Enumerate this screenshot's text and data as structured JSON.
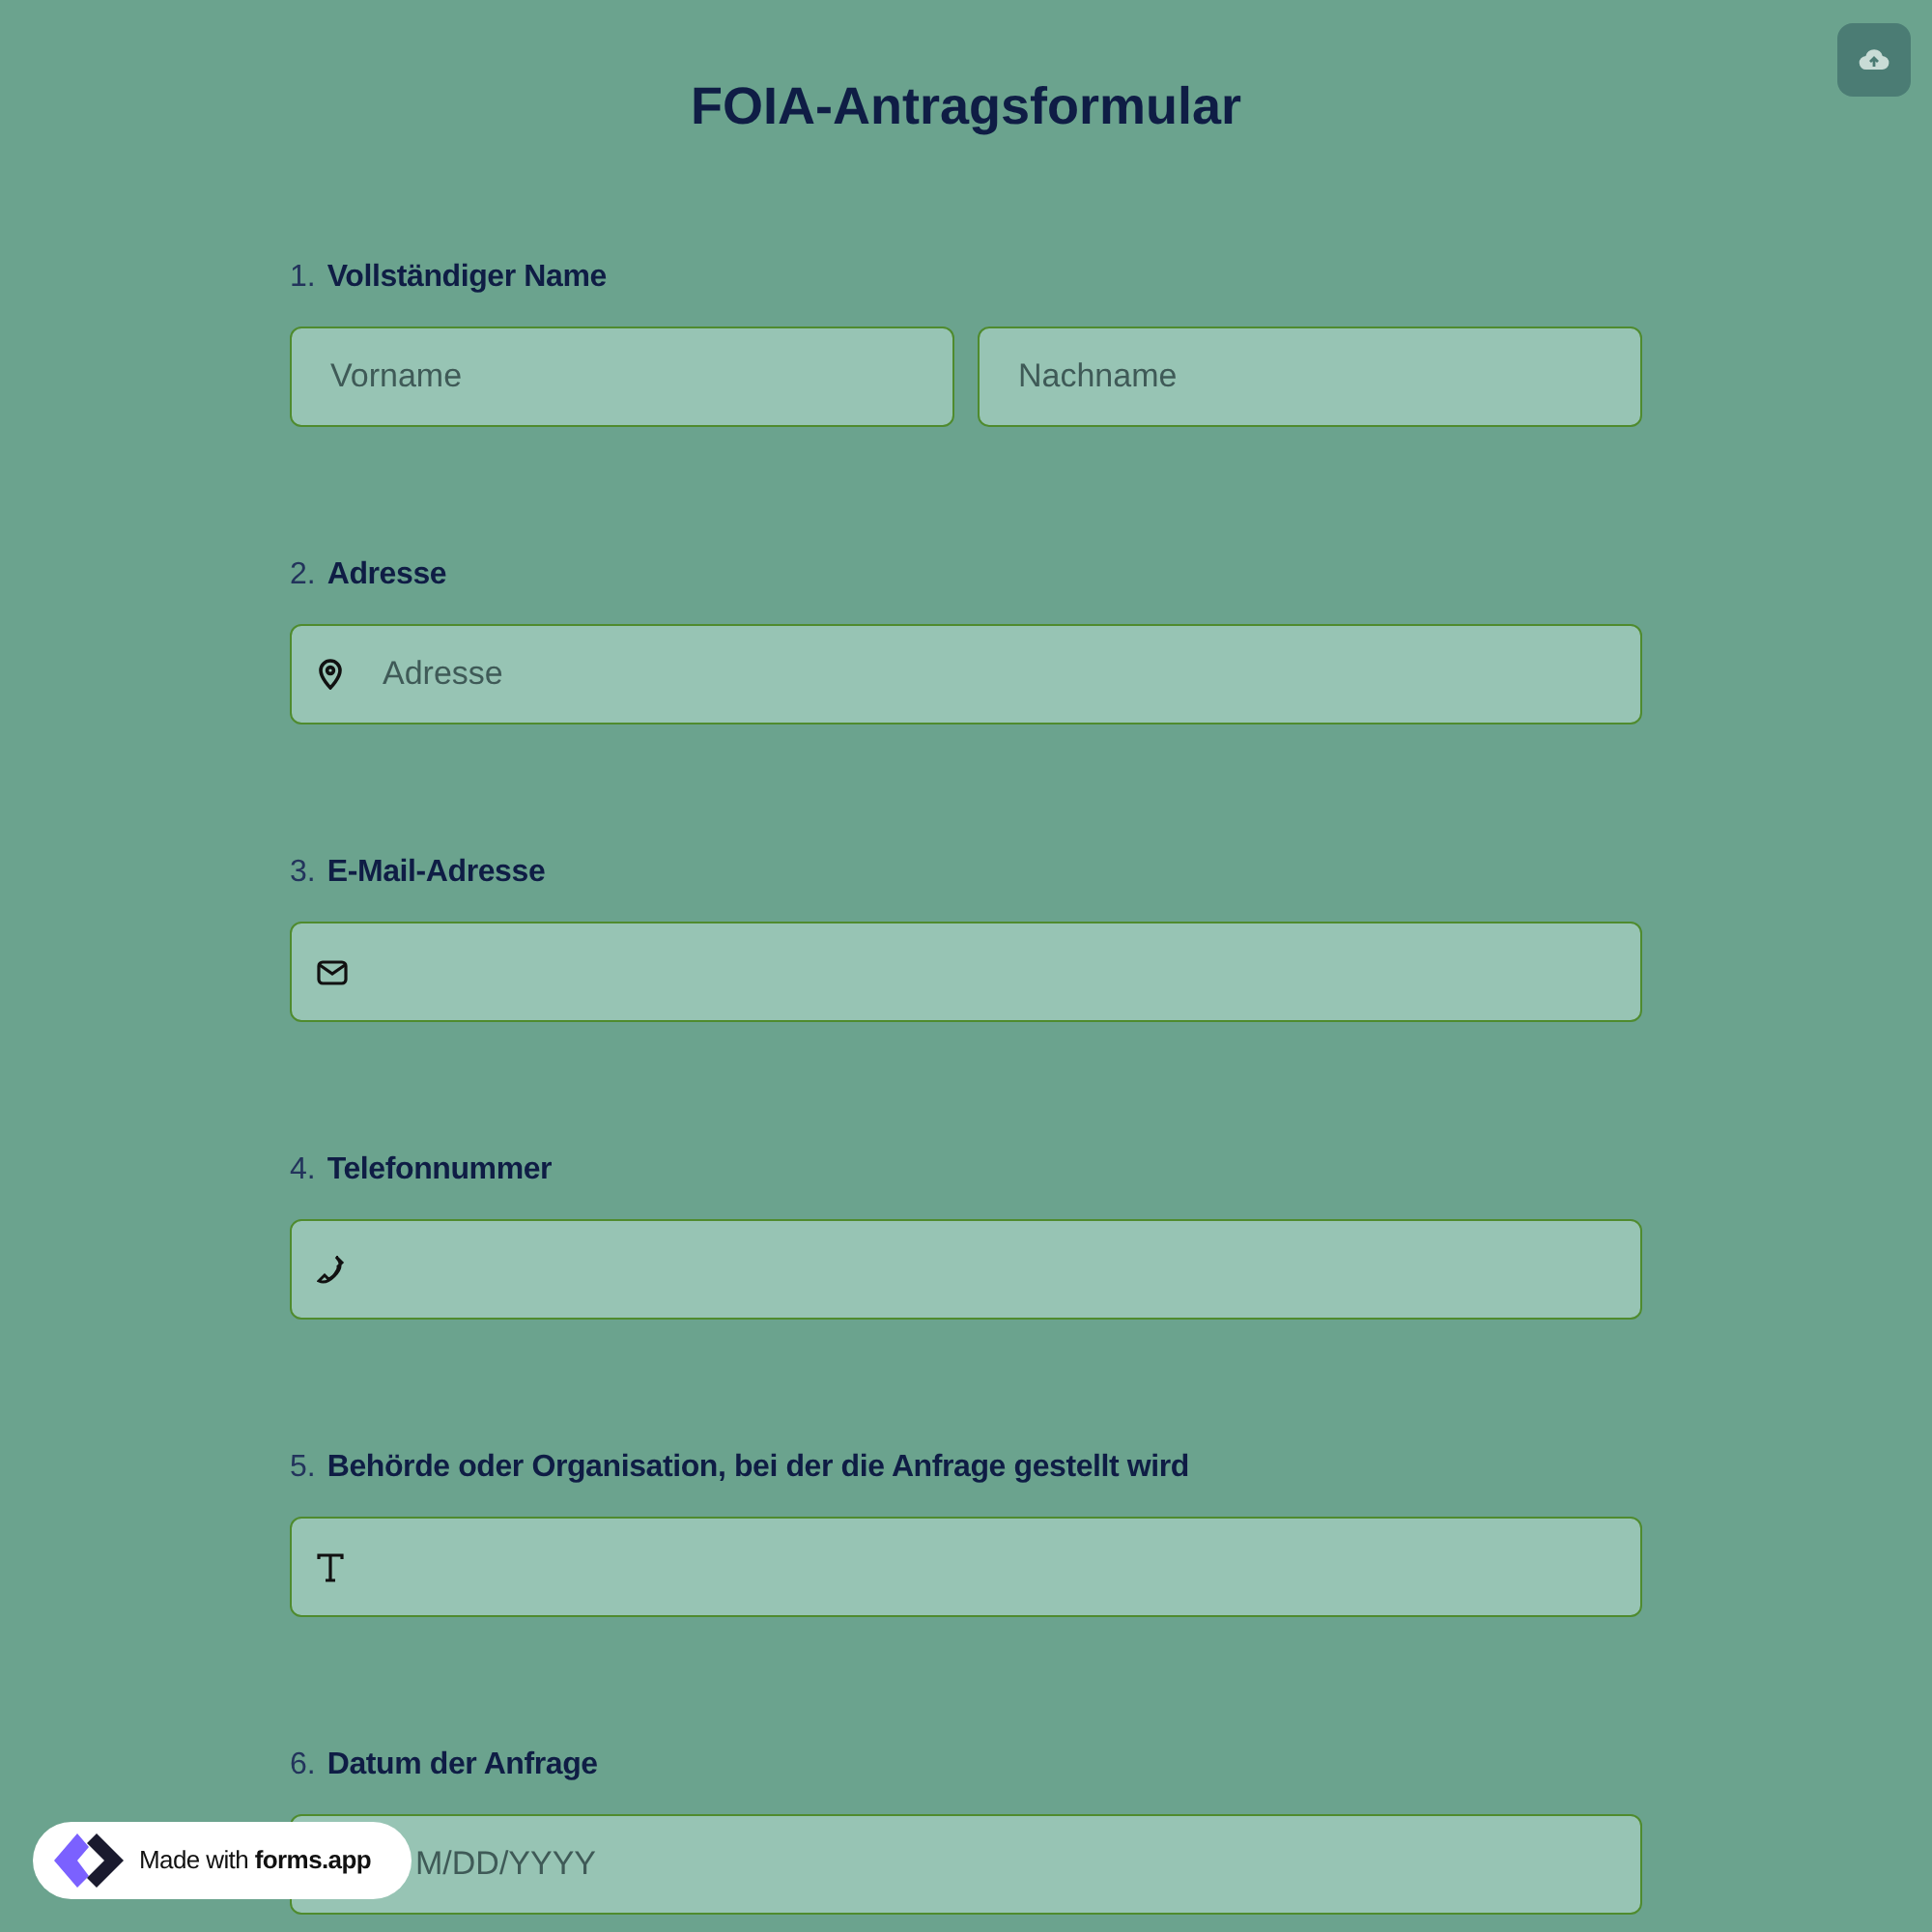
{
  "title": "FOIA-Antragsformular",
  "questions": [
    {
      "number": "1.",
      "label": "Vollständiger Name",
      "fields": [
        {
          "kind": "plain",
          "placeholder": "Vorname"
        },
        {
          "kind": "plain",
          "placeholder": "Nachname"
        }
      ]
    },
    {
      "number": "2.",
      "label": "Adresse",
      "fields": [
        {
          "kind": "address",
          "placeholder": "Adresse"
        }
      ]
    },
    {
      "number": "3.",
      "label": "E-Mail-Adresse",
      "fields": [
        {
          "kind": "email"
        }
      ]
    },
    {
      "number": "4.",
      "label": "Telefonnummer",
      "fields": [
        {
          "kind": "phone"
        }
      ]
    },
    {
      "number": "5.",
      "label": "Behörde oder Organisation, bei der die Anfrage gestellt wird",
      "fields": [
        {
          "kind": "text"
        }
      ]
    },
    {
      "number": "6.",
      "label": "Datum der Anfrage",
      "fields": [
        {
          "kind": "date",
          "placeholder": "M/DD/YYYY"
        }
      ]
    }
  ],
  "badge": {
    "text": "Made with **forms.app**"
  }
}
